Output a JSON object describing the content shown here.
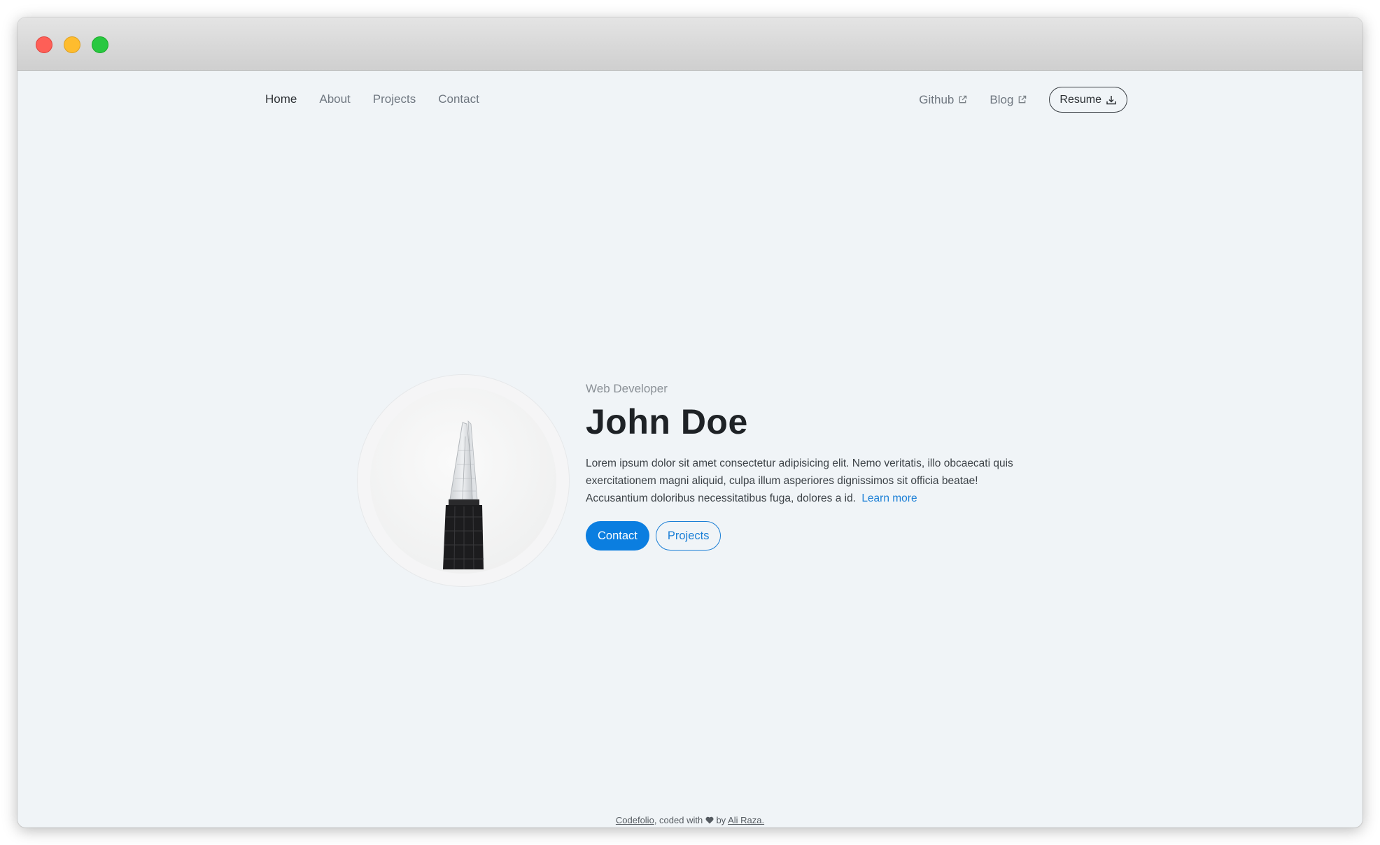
{
  "nav": {
    "links": [
      {
        "label": "Home"
      },
      {
        "label": "About"
      },
      {
        "label": "Projects"
      },
      {
        "label": "Contact"
      }
    ],
    "external": [
      {
        "label": "Github",
        "icon": "external-link-icon"
      },
      {
        "label": "Blog",
        "icon": "external-link-icon"
      }
    ],
    "resume": {
      "label": "Resume",
      "icon": "download-icon"
    }
  },
  "hero": {
    "subtitle": "Web Developer",
    "name": "John Doe",
    "description": "Lorem ipsum dolor sit amet consectetur adipisicing elit. Nemo veritatis, illo obcaecati quis exercitationem magni aliquid, culpa illum asperiores dignissimos sit officia beatae! Accusantium doloribus necessitatibus fuga, dolores a id.",
    "learn_more": "Learn more",
    "contact_button": "Contact",
    "projects_button": "Projects"
  },
  "footer": {
    "site": "Codefolio",
    "middle": ", coded with",
    "by": "by",
    "author": "Ali Raza."
  },
  "colors": {
    "accent": "#0b7ee0",
    "background": "#f0f4f7",
    "text": "#1e2226"
  }
}
